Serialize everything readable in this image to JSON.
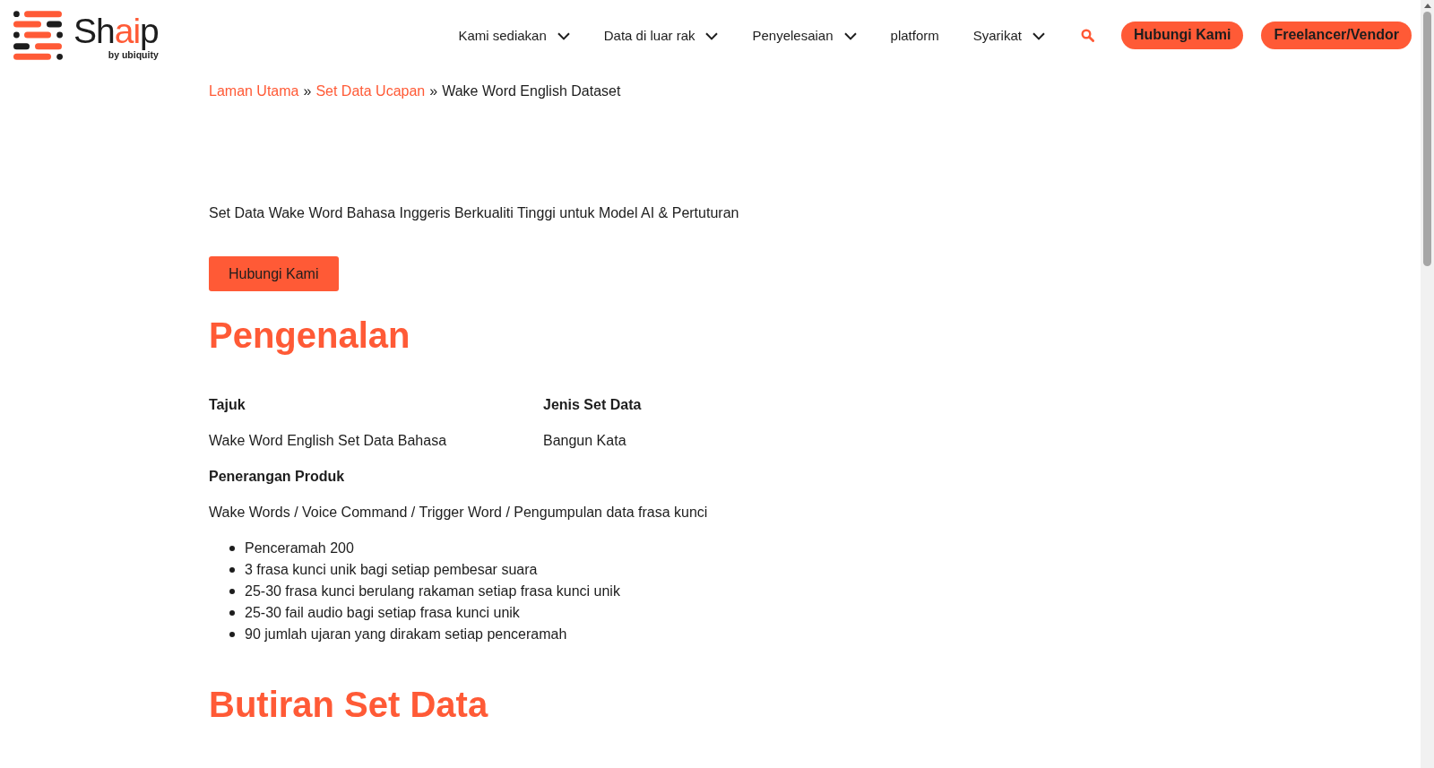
{
  "header": {
    "logo": {
      "wordmark": [
        {
          "text": "Sh",
          "accent": false
        },
        {
          "text": "ai",
          "accent": true
        },
        {
          "text": "p",
          "accent": false
        }
      ],
      "tagline": "by ubiquity"
    },
    "nav": [
      {
        "label": "Kami sediakan",
        "dropdown": true
      },
      {
        "label": "Data di luar rak",
        "dropdown": true
      },
      {
        "label": "Penyelesaian",
        "dropdown": true
      },
      {
        "label": "platform",
        "dropdown": false
      },
      {
        "label": "Syarikat",
        "dropdown": true
      }
    ],
    "buttons": [
      "Hubungi Kami",
      "Freelancer/Vendor"
    ]
  },
  "breadcrumb": [
    {
      "label": "Laman Utama",
      "link": true
    },
    {
      "separator_before": "»",
      "label": "Set Data Ucapan",
      "link": true
    },
    {
      "separator_before": "»",
      "label": "Wake Word English Dataset",
      "link": false
    }
  ],
  "hero": {
    "subtitle": "Set Data Wake Word Bahasa Inggeris Berkualiti Tinggi untuk Model AI & Pertuturan",
    "button": "Hubungi Kami"
  },
  "introduction": {
    "heading": "Pengenalan",
    "fields": [
      {
        "label": "Tajuk",
        "value": "Wake Word English Set Data Bahasa"
      },
      {
        "label": "Jenis Set Data",
        "value": "Bangun Kata"
      }
    ],
    "description_label": "Penerangan Produk",
    "description": "Wake Words / Voice Command / Trigger Word / Pengumpulan data frasa kunci",
    "bullets": [
      "Penceramah 200",
      "3 frasa kunci unik bagi setiap pembesar suara",
      "25-30 frasa kunci berulang rakaman setiap frasa kunci unik",
      "25-30 fail audio bagi setiap frasa kunci unik",
      "90 jumlah ujaran yang dirakam setiap penceramah"
    ]
  },
  "dataset_details": {
    "heading": "Butiran Set Data"
  }
}
